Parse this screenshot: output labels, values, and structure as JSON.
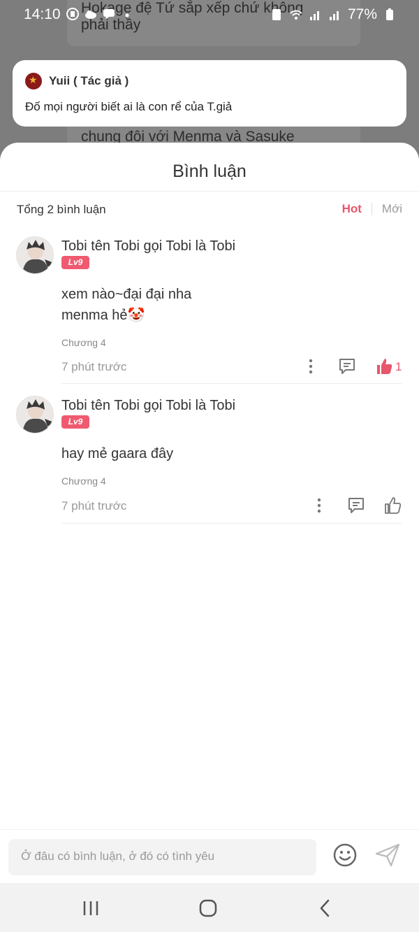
{
  "status_bar": {
    "time": "14:10",
    "battery": "77%"
  },
  "background": {
    "text_top": "Hokage đệ Tứ sắp xếp chứ không phải thầy",
    "text_bottom": "chung đôi với Menma và Sasuke"
  },
  "author_note": {
    "name": "Yuii ( Tác giả )",
    "message": "Đố mọi người biết ai là con rể của T.giả"
  },
  "comments_sheet": {
    "title": "Bình luận",
    "total": "Tổng 2 bình luận",
    "sort_hot": "Hot",
    "sort_new": "Mới"
  },
  "comments": [
    {
      "user": "Tobi tên Tobi gọi Tobi là Tobi",
      "level": "Lv9",
      "text_line1": "xem nào~đại đại nha",
      "text_line2": "menma hẻ🤡",
      "chapter": "Chương 4",
      "time": "7 phút trước",
      "likes": "1"
    },
    {
      "user": "Tobi tên Tobi gọi Tobi là Tobi",
      "level": "Lv9",
      "text_line1": "hay mẻ gaara đây",
      "chapter": "Chương 4",
      "time": "7 phút trước"
    }
  ],
  "input": {
    "placeholder": "Ở đâu có bình luận, ở đó có tình yêu"
  },
  "colors": {
    "accent": "#e8566b",
    "level_badge": "#ef5a70"
  },
  "icons": [
    "more-vertical-icon",
    "reply-icon",
    "thumbs-up-icon",
    "emoji-icon",
    "send-icon",
    "recent-apps-icon",
    "home-icon",
    "back-icon"
  ]
}
